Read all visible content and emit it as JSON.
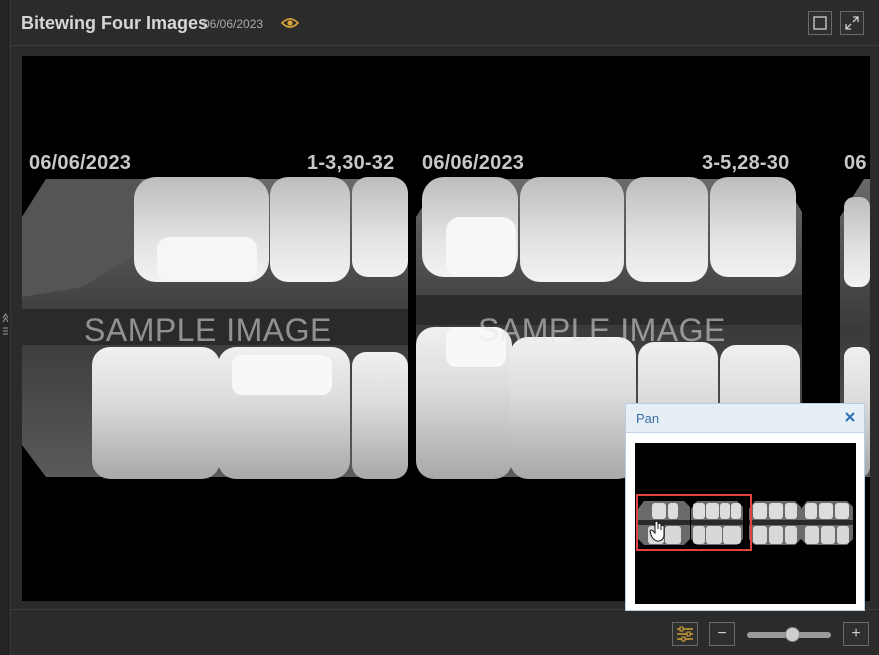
{
  "header": {
    "title": "Bitewing Four Images",
    "date": "06/06/2023"
  },
  "viewer": {
    "images": [
      {
        "date": "06/06/2023",
        "teeth": "1-3,30-32"
      },
      {
        "date": "06/06/2023",
        "teeth": "3-5,28-30"
      },
      {
        "date": "06"
      }
    ],
    "watermark": "SAMPLE IMAGE"
  },
  "pan": {
    "title": "Pan"
  },
  "footer": {
    "zoom_out": "−",
    "zoom_in": "+",
    "zoom_level": 0.55
  },
  "colors": {
    "accent": "#d9a53a",
    "pan_title": "#3d6fa8",
    "pan_rect": "#e0443c"
  },
  "icons": [
    "eye-icon",
    "single-view-icon",
    "fullscreen-icon",
    "settings-sliders-icon",
    "close-icon",
    "hand-cursor-icon"
  ]
}
